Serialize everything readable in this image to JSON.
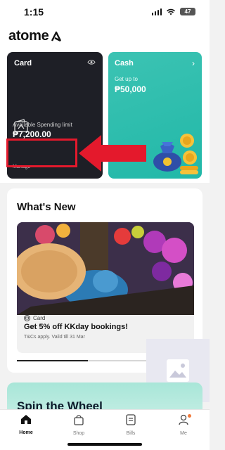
{
  "status_bar": {
    "time": "1:15",
    "battery": "47"
  },
  "header": {
    "brand": "atome"
  },
  "card_tile": {
    "title": "Card",
    "limit_label": "Available Spending limit",
    "limit_value": "₱7,200.00",
    "manage": "Manage"
  },
  "cash_tile": {
    "title": "Cash",
    "get_up_to": "Get up to",
    "amount": "₱50,000"
  },
  "whats_new": {
    "title": "What's New",
    "promo": {
      "tag": "Card",
      "headline": "Get 5% off KKday bookings!",
      "terms": "T&Cs apply. Valid till 31 Mar"
    },
    "carousel_progress": 0.4
  },
  "spin": {
    "title": "Spin the Wheel"
  },
  "tabs": [
    {
      "label": "Home",
      "icon": "home-icon",
      "active": true
    },
    {
      "label": "Shop",
      "icon": "shopping-bag-icon",
      "active": false
    },
    {
      "label": "Bills",
      "icon": "bill-icon",
      "active": false
    },
    {
      "label": "Me",
      "icon": "profile-icon",
      "active": false
    }
  ],
  "colors": {
    "accent_red": "#e4192c",
    "cash_teal": "#21b8a8",
    "card_dark": "#1e1f26",
    "notification": "#f07a3b"
  }
}
